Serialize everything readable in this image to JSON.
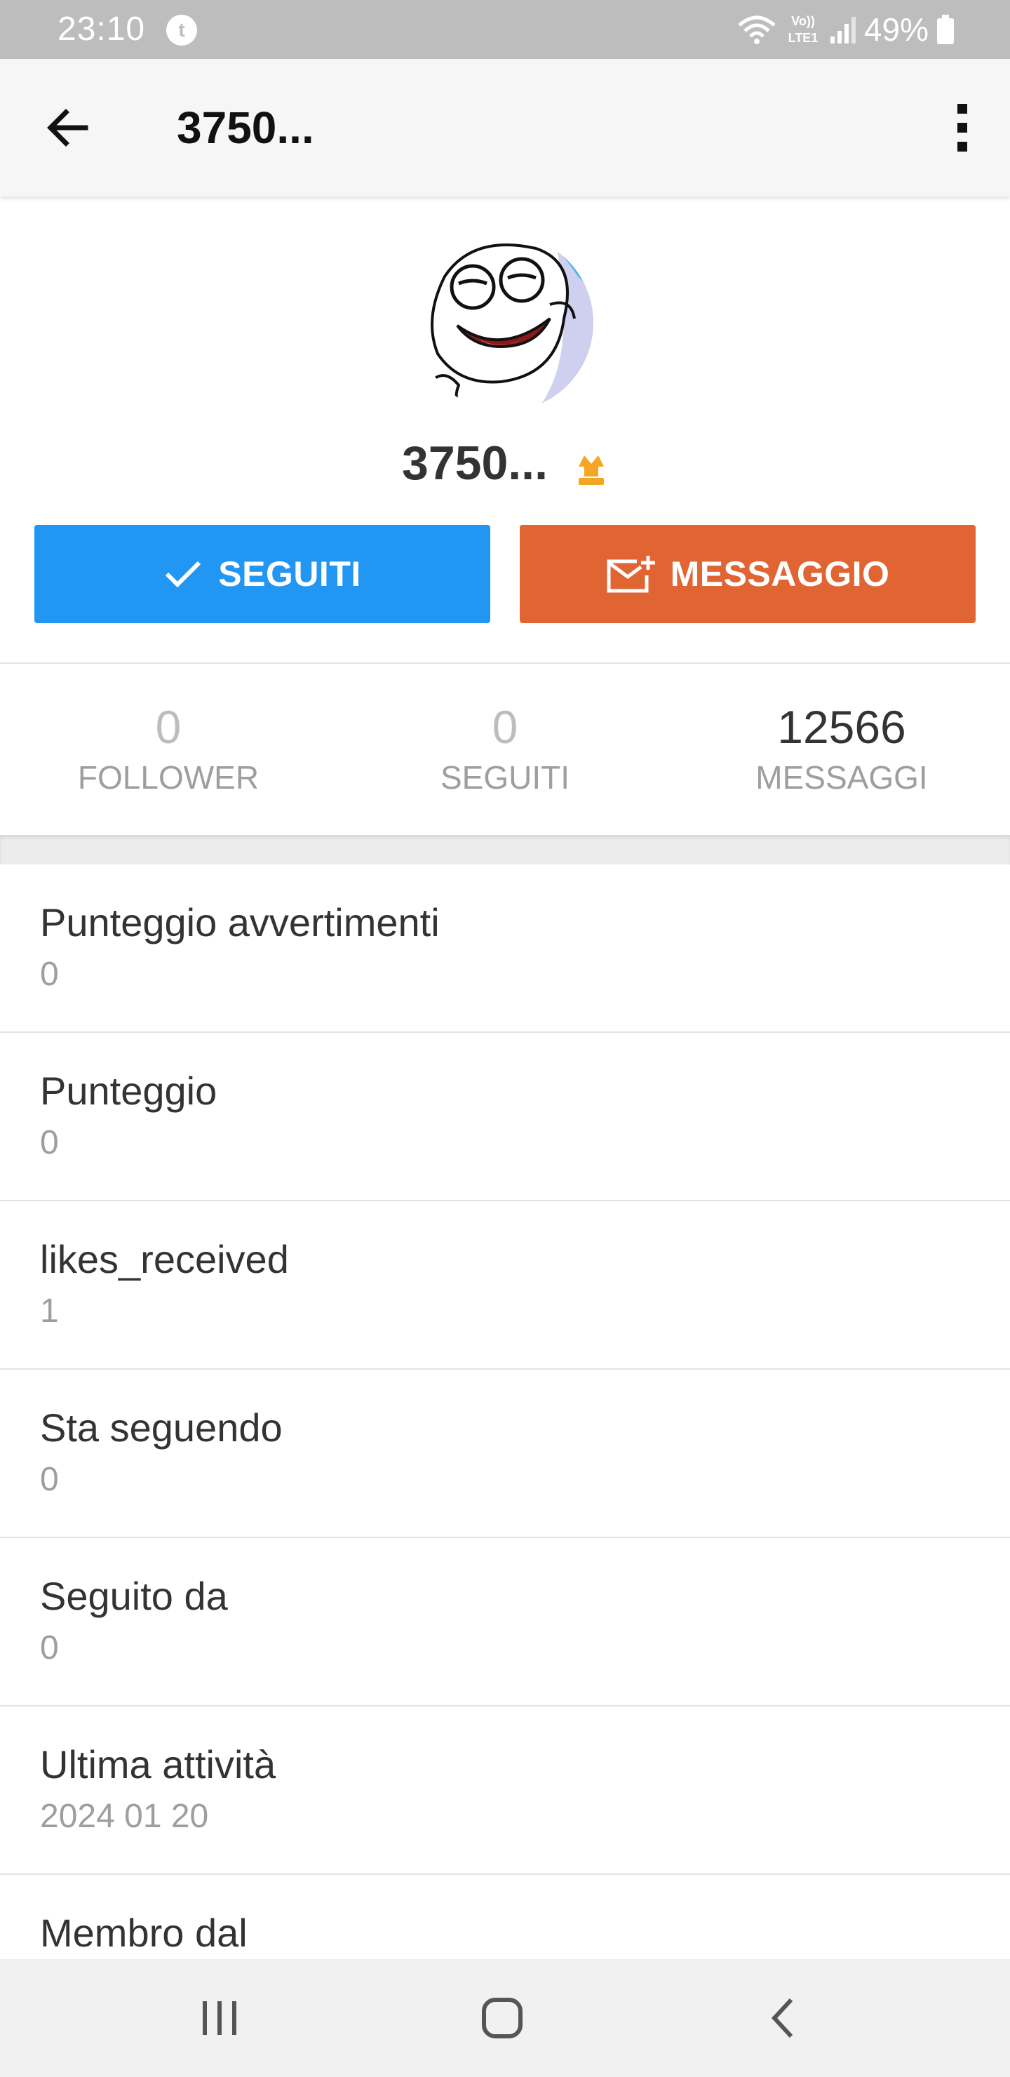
{
  "status_bar": {
    "time": "23:10",
    "network_label": "LTE1",
    "volte_label": "Vo))",
    "battery_percent": "49%"
  },
  "toolbar": {
    "title": "3750...",
    "back_icon": "arrow-left-icon",
    "more_icon": "more-vert-icon"
  },
  "profile": {
    "username": "3750...",
    "follow_button": "SEGUITI",
    "message_button": "MESSAGGIO",
    "colors": {
      "follow": "#2196f3",
      "message": "#e06533",
      "rank": "#f5a623"
    }
  },
  "stats": [
    {
      "value": "0",
      "label": "FOLLOWER"
    },
    {
      "value": "0",
      "label": "SEGUITI"
    },
    {
      "value": "12566",
      "label": "MESSAGGI"
    }
  ],
  "info": [
    {
      "label": "Punteggio avvertimenti",
      "value": "0"
    },
    {
      "label": "Punteggio",
      "value": "0"
    },
    {
      "label": "likes_received",
      "value": "1"
    },
    {
      "label": "Sta seguendo",
      "value": "0"
    },
    {
      "label": "Seguito da",
      "value": "0"
    },
    {
      "label": "Ultima attività",
      "value": "2024 01 20"
    },
    {
      "label": "Membro dal",
      "value": ""
    }
  ],
  "nav_bar": {
    "icons": [
      "recent-apps-icon",
      "home-icon",
      "back-icon"
    ]
  }
}
